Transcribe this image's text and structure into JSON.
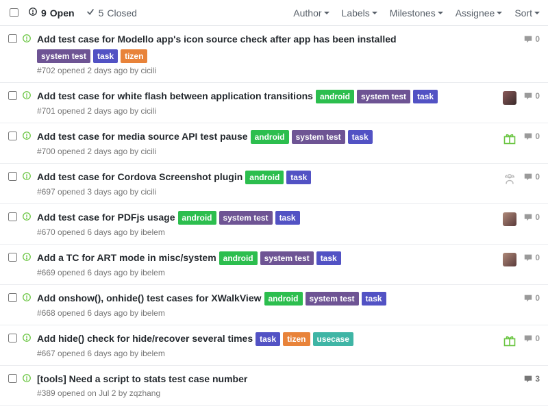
{
  "toolbar": {
    "open_count": "9",
    "open_label": "Open",
    "closed_count": "5",
    "closed_label": "Closed",
    "filters": {
      "author": "Author",
      "labels": "Labels",
      "milestones": "Milestones",
      "assignee": "Assignee",
      "sort": "Sort"
    }
  },
  "label_colors": {
    "system_test": "#6e5494",
    "task": "#5252c4",
    "tizen": "#e8833a",
    "android": "#2cbe4e",
    "usecase": "#3fb5a5"
  },
  "issues": [
    {
      "title": "Add test case for Modello app's icon source check after app has been installed",
      "labels": [
        {
          "text": "system test",
          "color": "#6e5494"
        },
        {
          "text": "task",
          "color": "#5252c4"
        },
        {
          "text": "tizen",
          "color": "#e8833a"
        }
      ],
      "labels_below": true,
      "meta": "#702 opened 2 days ago by cicili",
      "assignee": null,
      "comments": "0",
      "has_comments": false
    },
    {
      "title": "Add test case for white flash between application transitions",
      "labels": [
        {
          "text": "android",
          "color": "#2cbe4e"
        },
        {
          "text": "system test",
          "color": "#6e5494"
        },
        {
          "text": "task",
          "color": "#5252c4"
        }
      ],
      "labels_below": false,
      "meta": "#701 opened 2 days ago by cicili",
      "assignee": "a1",
      "comments": "0",
      "has_comments": false
    },
    {
      "title": "Add test case for media source API test pause",
      "labels": [
        {
          "text": "android",
          "color": "#2cbe4e"
        },
        {
          "text": "system test",
          "color": "#6e5494"
        },
        {
          "text": "task",
          "color": "#5252c4"
        }
      ],
      "labels_below": false,
      "meta": "#700 opened 2 days ago by cicili",
      "assignee": "gift",
      "comments": "0",
      "has_comments": false
    },
    {
      "title": "Add test case for Cordova Screenshot plugin",
      "labels": [
        {
          "text": "android",
          "color": "#2cbe4e"
        },
        {
          "text": "task",
          "color": "#5252c4"
        }
      ],
      "labels_below": false,
      "meta": "#697 opened 3 days ago by cicili",
      "assignee": "chef",
      "comments": "0",
      "has_comments": false
    },
    {
      "title": "Add test case for PDFjs usage",
      "labels": [
        {
          "text": "android",
          "color": "#2cbe4e"
        },
        {
          "text": "system test",
          "color": "#6e5494"
        },
        {
          "text": "task",
          "color": "#5252c4"
        }
      ],
      "labels_below": false,
      "meta": "#670 opened 6 days ago by ibelem",
      "assignee": "a3",
      "comments": "0",
      "has_comments": false
    },
    {
      "title": "Add a TC for ART mode in misc/system",
      "labels": [
        {
          "text": "android",
          "color": "#2cbe4e"
        },
        {
          "text": "system test",
          "color": "#6e5494"
        },
        {
          "text": "task",
          "color": "#5252c4"
        }
      ],
      "labels_below": false,
      "meta": "#669 opened 6 days ago by ibelem",
      "assignee": "a3",
      "comments": "0",
      "has_comments": false
    },
    {
      "title": "Add onshow(), onhide() test cases for XWalkView",
      "labels": [
        {
          "text": "android",
          "color": "#2cbe4e"
        },
        {
          "text": "system test",
          "color": "#6e5494"
        },
        {
          "text": "task",
          "color": "#5252c4"
        }
      ],
      "labels_below": false,
      "meta": "#668 opened 6 days ago by ibelem",
      "assignee": null,
      "comments": "0",
      "has_comments": false
    },
    {
      "title": "Add hide() check for hide/recover several times",
      "labels": [
        {
          "text": "task",
          "color": "#5252c4"
        },
        {
          "text": "tizen",
          "color": "#e8833a"
        },
        {
          "text": "usecase",
          "color": "#3fb5a5"
        }
      ],
      "labels_below": false,
      "meta": "#667 opened 6 days ago by ibelem",
      "assignee": "gift",
      "comments": "0",
      "has_comments": false
    },
    {
      "title": "[tools] Need a script to stats test case number",
      "labels": [],
      "labels_below": false,
      "meta": "#389 opened on Jul 2 by zqzhang",
      "assignee": null,
      "comments": "3",
      "has_comments": true
    }
  ]
}
